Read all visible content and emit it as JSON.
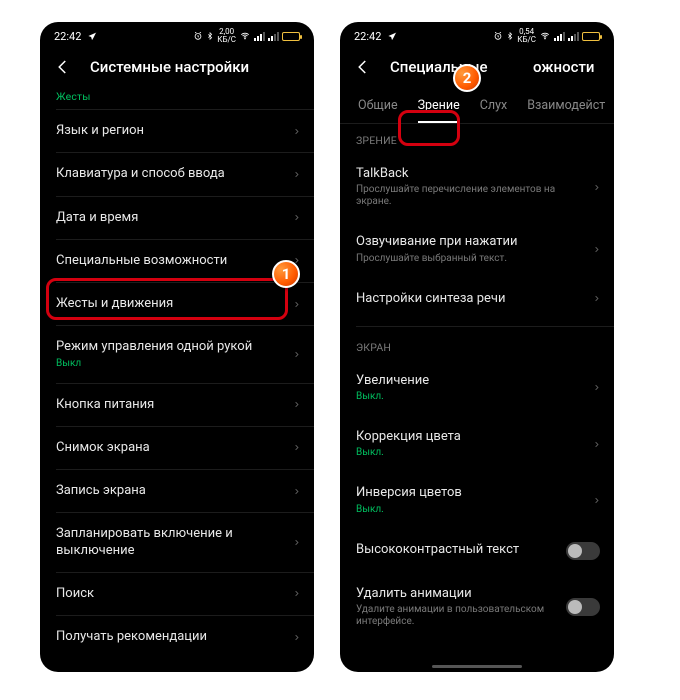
{
  "left": {
    "status": {
      "time": "22:42",
      "net_rate": "2,00",
      "net_unit": "КБ/С"
    },
    "header": {
      "title": "Системные настройки"
    },
    "section_label": "Жесты",
    "items": [
      {
        "title": "Язык и регион"
      },
      {
        "title": "Клавиатура и способ ввода"
      },
      {
        "title": "Дата и время"
      },
      {
        "title": "Специальные возможности"
      },
      {
        "title": "Жесты и движения"
      },
      {
        "title": "Режим управления одной рукой",
        "sub": "Выкл",
        "sub_green": true
      },
      {
        "title": "Кнопка питания"
      },
      {
        "title": "Снимок экрана"
      },
      {
        "title": "Запись экрана"
      },
      {
        "title": "Запланировать включение и выключение"
      },
      {
        "title": "Поиск"
      },
      {
        "title": "Получать рекомендации"
      }
    ],
    "badge": "1"
  },
  "right": {
    "status": {
      "time": "22:42",
      "net_rate": "0,54",
      "net_unit": "КБ/С"
    },
    "header": {
      "title_prefix": "Специальные",
      "title_suffix": "ожности"
    },
    "tabs": [
      "Общие",
      "Зрение",
      "Слух",
      "Взаимодейст"
    ],
    "active_tab_index": 1,
    "section1_label": "ЗРЕНИЕ",
    "section1_items": [
      {
        "title": "TalkBack",
        "sub": "Прослушайте перечисление элементов на экране."
      },
      {
        "title": "Озвучивание при нажатии",
        "sub": "Прослушайте выбранный текст."
      },
      {
        "title": "Настройки синтеза речи"
      }
    ],
    "section2_label": "ЭКРАН",
    "section2_items": [
      {
        "title": "Увеличение",
        "sub": "Выкл.",
        "sub_green": true
      },
      {
        "title": "Коррекция цвета",
        "sub": "Выкл.",
        "sub_green": true
      },
      {
        "title": "Инверсия цветов",
        "sub": "Выкл.",
        "sub_green": true
      },
      {
        "title": "Высококонтрастный текст",
        "toggle": true
      },
      {
        "title": "Удалить анимации",
        "sub": "Удалите анимации в пользовательском интерфейсе.",
        "toggle": true
      }
    ],
    "badge": "2"
  }
}
